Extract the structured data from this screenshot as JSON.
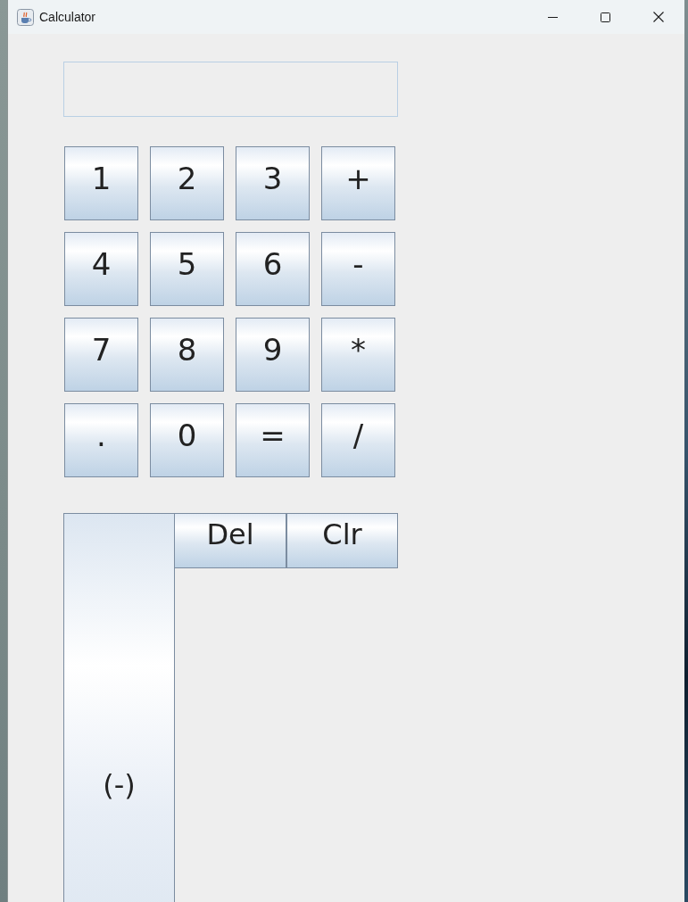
{
  "window": {
    "title": "Calculator"
  },
  "keypad": [
    "1",
    "2",
    "3",
    "+",
    "4",
    "5",
    "6",
    "-",
    "7",
    "8",
    "9",
    "*",
    ".",
    "0",
    "=",
    "/"
  ],
  "negate_button": "(-)",
  "edit_buttons": [
    "Del",
    "Clr"
  ]
}
